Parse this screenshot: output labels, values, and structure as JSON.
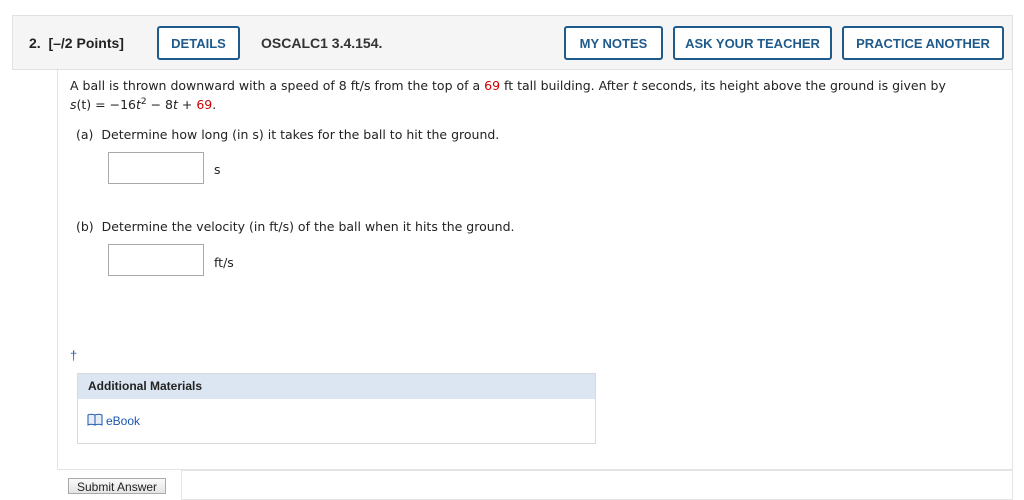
{
  "header": {
    "question_number": "2.",
    "points": "[–/2 Points]",
    "details_label": "DETAILS",
    "question_code": "OSCALC1 3.4.154.",
    "my_notes_label": "MY NOTES",
    "ask_teacher_label": "ASK YOUR TEACHER",
    "practice_label": "PRACTICE ANOTHER"
  },
  "problem": {
    "intro_a": "A ball is thrown downward with a speed of 8 ft/s from the top of a ",
    "height_value": "69",
    "intro_b": " ft tall building. After ",
    "t_var": "t",
    "intro_c": " seconds, its height above the ground is given by",
    "eq_s": "s",
    "eq_paren_t": "(t)",
    "eq_mid": " = −16",
    "eq_t1": "t",
    "eq_exp": "2",
    "eq_minus": " − 8",
    "eq_t2": "t",
    "eq_plus": " + ",
    "eq_const": "69",
    "eq_period": "."
  },
  "parts": {
    "a_label": "(a)",
    "a_text": "Determine how long (in s) it takes for the ball to hit the ground.",
    "a_value": "",
    "a_unit": "s",
    "b_label": "(b)",
    "b_text": "Determine the velocity (in ft/s) of the ball when it hits the ground.",
    "b_value": "",
    "b_unit": "ft/s"
  },
  "additional_materials": {
    "dagger": "†",
    "heading": "Additional Materials",
    "ebook_label": "eBook",
    "ebook_icon": "book-icon"
  },
  "footer": {
    "submit_label": "Submit Answer"
  },
  "colors": {
    "accent": "#1f5a8c",
    "highlight_red": "#cc0000",
    "panel_header": "#dce6f2"
  }
}
